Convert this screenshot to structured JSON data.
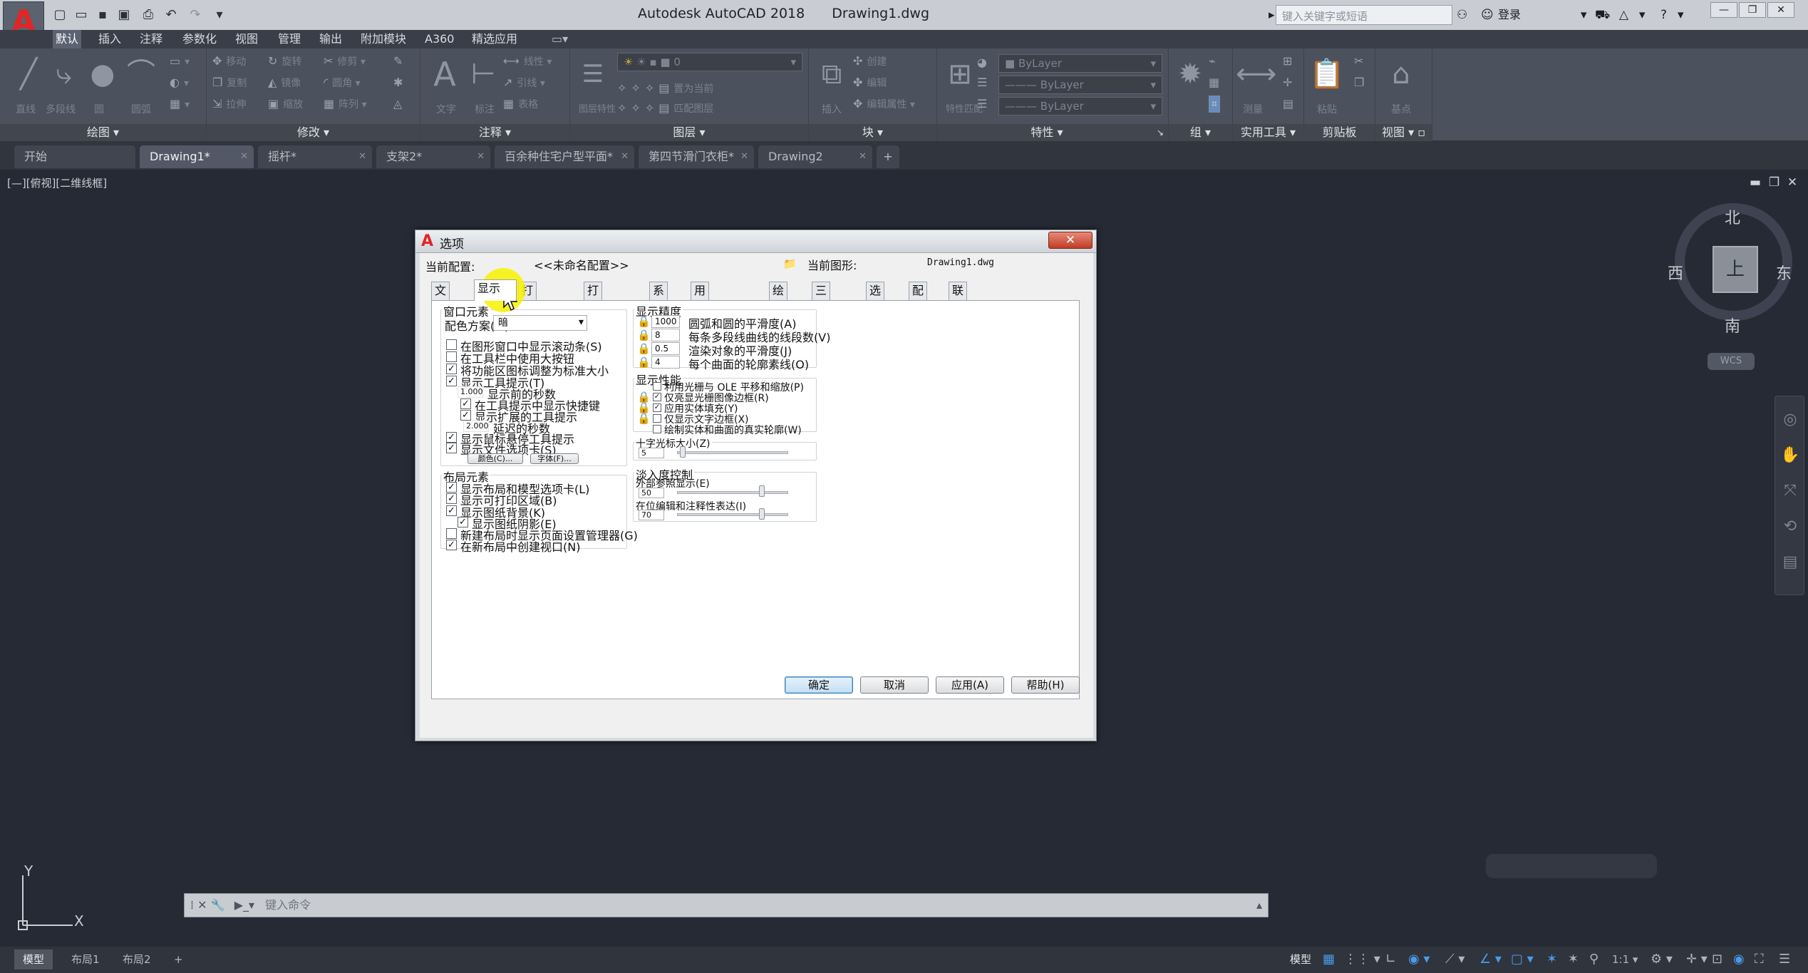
{
  "app": {
    "title": "Autodesk AutoCAD 2018",
    "document": "Drawing1.dwg",
    "app_letter": "A",
    "search_placeholder": "键入关键字或短语",
    "login": "登录"
  },
  "ribbon_tabs": [
    "默认",
    "插入",
    "注释",
    "参数化",
    "视图",
    "管理",
    "输出",
    "附加模块",
    "A360",
    "精选应用"
  ],
  "ribbon_panels": {
    "draw": {
      "label": "绘图",
      "tools": [
        "直线",
        "多段线",
        "圆",
        "圆弧"
      ]
    },
    "modify": {
      "label": "修改",
      "tools": [
        "移动",
        "旋转",
        "修剪",
        "复制",
        "镜像",
        "圆角",
        "拉伸",
        "缩放",
        "阵列"
      ]
    },
    "annotate": {
      "label": "注释",
      "tools": [
        "文字",
        "标注",
        "线性",
        "引线",
        "表格"
      ]
    },
    "layers": {
      "label": "图层",
      "tools": [
        "图层特性",
        "置为当前",
        "匹配图层"
      ],
      "layer_value": "0"
    },
    "block": {
      "label": "块",
      "tools": [
        "插入",
        "创建",
        "编辑",
        "编辑属性"
      ]
    },
    "properties": {
      "label": "特性",
      "tools": [
        "特性匹配"
      ],
      "color": "ByLayer",
      "linetype": "ByLayer",
      "lineweight": "ByLayer"
    },
    "groups": {
      "label": "组"
    },
    "utilities": {
      "label": "实用工具",
      "tools": [
        "测量"
      ]
    },
    "clipboard": {
      "label": "剪贴板",
      "tools": [
        "粘贴"
      ]
    },
    "view": {
      "label": "视图",
      "tools": [
        "基点"
      ]
    }
  },
  "file_tabs": [
    "开始",
    "Drawing1*",
    "摇杆*",
    "支架2*",
    "百余种住宅户型平面*",
    "第四节滑门衣柜*",
    "Drawing2"
  ],
  "viewport": {
    "label": "[—][俯视][二维线框]",
    "compass": {
      "n": "北",
      "s": "南",
      "e": "东",
      "w": "西",
      "face": "上",
      "wcs": "WCS"
    },
    "ucs_y": "Y",
    "ucs_x": "X"
  },
  "command_line": {
    "placeholder": "键入命令"
  },
  "status": {
    "tabs": [
      "模型",
      "布局1",
      "布局2"
    ],
    "model": "模型",
    "scale": "1:1"
  },
  "dialog": {
    "title": "选项",
    "current_profile_label": "当前配置:",
    "current_profile": "<<未命名配置>>",
    "current_drawing_label": "当前图形:",
    "current_drawing": "Drawing1.dwg",
    "tabs": [
      "文件",
      "显示",
      "打开和保存",
      "打印和发布",
      "系统",
      "用户系统配置",
      "绘图",
      "三维建模",
      "选择集",
      "配置",
      "联机"
    ],
    "active_tab": "显示",
    "window_elements": {
      "title": "窗口元素",
      "scheme_label": "配色方案(M):",
      "scheme_value": "暗",
      "options": [
        {
          "label": "在图形窗口中显示滚动条(S)",
          "checked": false
        },
        {
          "label": "在工具栏中使用大按钮",
          "checked": false
        },
        {
          "label": "将功能区图标调整为标准大小",
          "checked": true
        },
        {
          "label": "显示工具提示(T)",
          "checked": true
        }
      ],
      "tooltip_delay": "1.000",
      "tooltip_delay_label": "显示前的秒数",
      "sub_options": [
        {
          "label": "在工具提示中显示快捷键",
          "checked": true
        },
        {
          "label": "显示扩展的工具提示",
          "checked": true
        }
      ],
      "ext_delay": "2.000",
      "ext_delay_label": "延迟的秒数",
      "more_options": [
        {
          "label": "显示鼠标悬停工具提示",
          "checked": true
        },
        {
          "label": "显示文件选项卡(S)",
          "checked": true
        }
      ],
      "colors_button": "颜色(C)...",
      "fonts_button": "字体(F)..."
    },
    "layout_elements": {
      "title": "布局元素",
      "options": [
        {
          "label": "显示布局和模型选项卡(L)",
          "checked": true
        },
        {
          "label": "显示可打印区域(B)",
          "checked": true
        },
        {
          "label": "显示图纸背景(K)",
          "checked": true
        },
        {
          "label": "显示图纸阴影(E)",
          "checked": true
        },
        {
          "label": "新建布局时显示页面设置管理器(G)",
          "checked": false
        },
        {
          "label": "在新布局中创建视口(N)",
          "checked": true
        }
      ]
    },
    "display_resolution": {
      "title": "显示精度",
      "items": [
        {
          "value": "1000",
          "label": "圆弧和圆的平滑度(A)"
        },
        {
          "value": "8",
          "label": "每条多段线曲线的线段数(V)"
        },
        {
          "value": "0.5",
          "label": "渲染对象的平滑度(J)"
        },
        {
          "value": "4",
          "label": "每个曲面的轮廓素线(O)"
        }
      ]
    },
    "display_performance": {
      "title": "显示性能",
      "options": [
        {
          "label": "利用光栅与 OLE 平移和缩放(P)",
          "checked": false
        },
        {
          "label": "仅亮显光栅图像边框(R)",
          "checked": true
        },
        {
          "label": "应用实体填充(Y)",
          "checked": true
        },
        {
          "label": "仅显示文字边框(X)",
          "checked": false
        },
        {
          "label": "绘制实体和曲面的真实轮廓(W)",
          "checked": false
        }
      ]
    },
    "crosshair": {
      "title": "十字光标大小(Z)",
      "value": "5",
      "fraction": 0.05
    },
    "fade": {
      "title": "淡入度控制",
      "xref_label": "外部参照显示(E)",
      "xref_value": "50",
      "xref_fraction": 0.76,
      "inplace_label": "在位编辑和注释性表达(I)",
      "inplace_value": "70",
      "inplace_fraction": 0.76
    },
    "buttons": {
      "ok": "确定",
      "cancel": "取消",
      "apply": "应用(A)",
      "help": "帮助(H)"
    }
  }
}
